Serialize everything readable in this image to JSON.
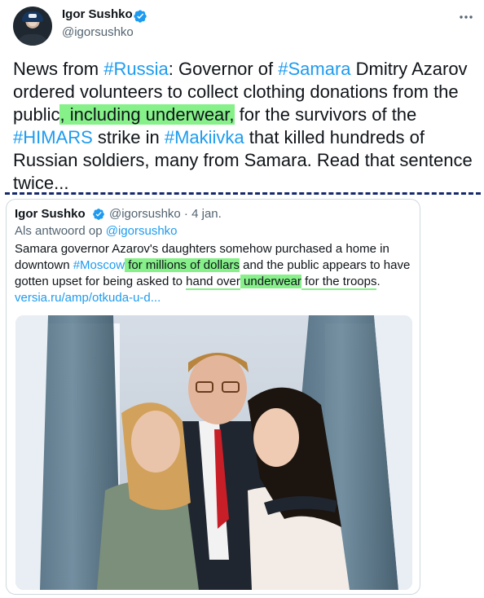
{
  "tweet": {
    "author_name": "Igor Sushko",
    "author_handle": "@igorsushko",
    "text": {
      "p1": "News from ",
      "tag_russia": "#Russia",
      "p2": ": Governor of ",
      "tag_samara": "#Samara",
      "p3": " Dmitry Azarov ordered volunteers to collect clothing donations from the public",
      "highlight": ", including underwear,",
      "p4": " for the survivors of the ",
      "tag_himars": "#HIMARS",
      "p5": " strike in ",
      "tag_makiivka": "#Makiivka",
      "p6": " that killed hundreds of Russian soldiers, many from Samara. Read that sentence twice..."
    }
  },
  "quoted": {
    "author_name": "Igor Sushko",
    "handle_date": "@igorsushko · 4 jan.",
    "reply_prefix": "Als antwoord op ",
    "reply_mention": "@igorsushko",
    "text": {
      "p1": "Samara governor Azarov's daughters somehow purchased a home in downtown ",
      "tag_moscow": "#Moscow",
      "hl1": " for millions of dollars",
      "p2": " and the public appears to have gotten upset for being asked to ",
      "ul1": "hand over",
      "hl2": " underwear",
      "ul2": " for the troops",
      "p3": ".",
      "link": "versia.ru/amp/otkuda-u-d..."
    }
  },
  "colors": {
    "accent": "#1d9bf0",
    "highlight": "#86f089",
    "separator": "#14286e"
  },
  "icons": [
    "verified-badge-icon",
    "more-options-icon"
  ]
}
